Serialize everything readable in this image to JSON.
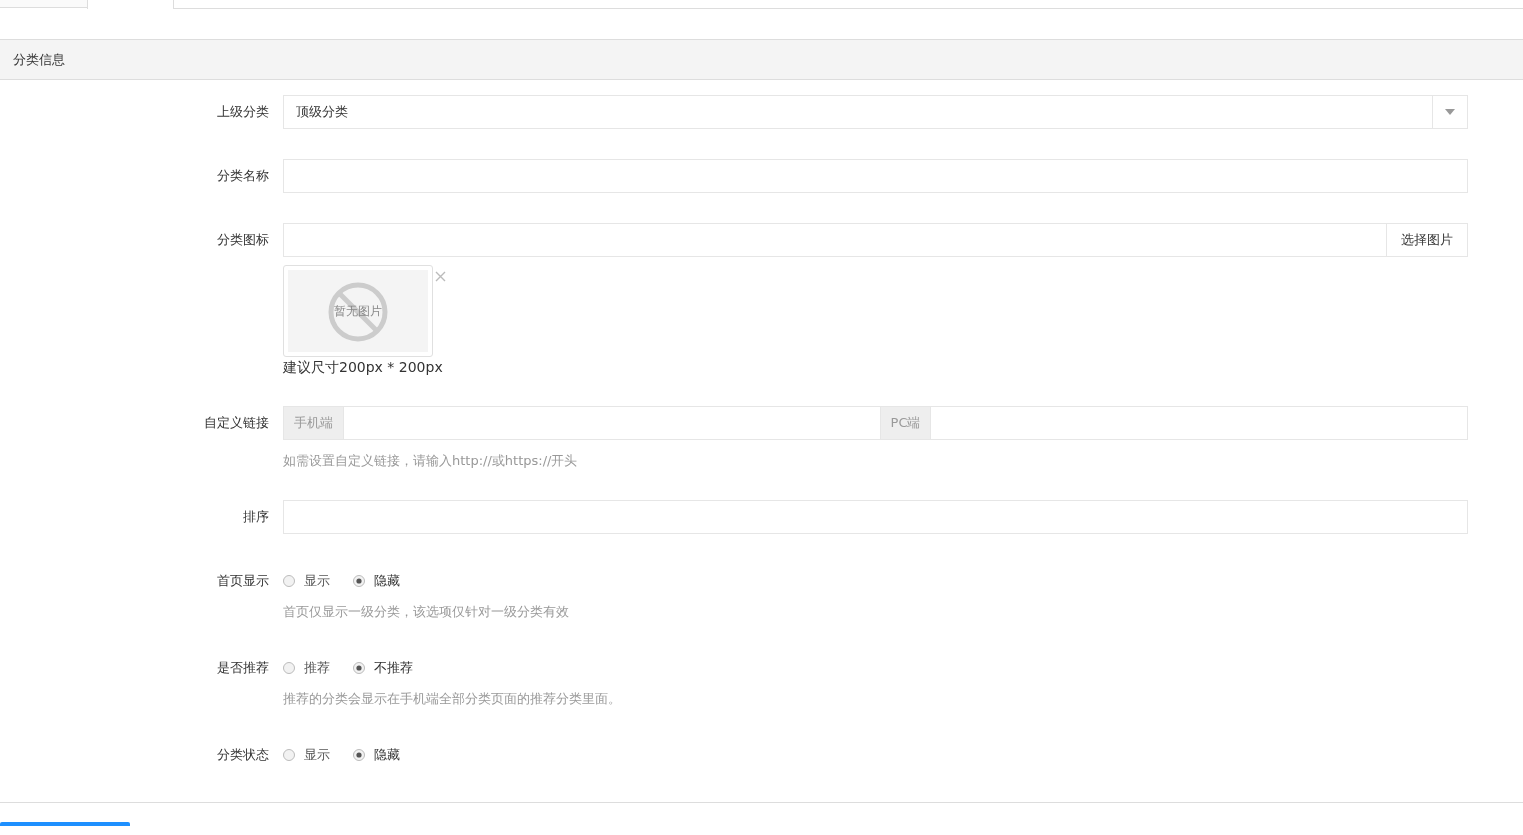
{
  "tabs": [
    {
      "selected": false
    },
    {
      "selected": true
    }
  ],
  "panel": {
    "title": "分类信息"
  },
  "fields": [
    {
      "kind": "select",
      "label": "上级分类",
      "value": "顶级分类"
    },
    {
      "kind": "text",
      "label": "分类名称"
    },
    {
      "kind": "image",
      "label": "分类图标",
      "button": "选择图片",
      "preview": "暂无图片",
      "hint": "建议尺寸200px * 200px"
    },
    {
      "kind": "link",
      "label": "自定义链接",
      "addons": [
        "手机端",
        "PC端"
      ],
      "hint": "如需设置自定义链接，请输入http://或https://开头"
    },
    {
      "kind": "text",
      "label": "排序"
    },
    {
      "kind": "radio",
      "label": "首页显示",
      "options": [
        {
          "label": "显示",
          "selected": false
        },
        {
          "label": "隐藏",
          "selected": true
        }
      ],
      "hint": "首页仅显示一级分类，该选项仅针对一级分类有效"
    },
    {
      "kind": "radio",
      "label": "是否推荐",
      "options": [
        {
          "label": "推荐",
          "selected": false
        },
        {
          "label": "不推荐",
          "selected": true
        }
      ],
      "hint": "推荐的分类会显示在手机端全部分类页面的推荐分类里面。"
    },
    {
      "kind": "radio",
      "label": "分类状态",
      "options": [
        {
          "label": "显示",
          "selected": false
        },
        {
          "label": "隐藏",
          "selected": true
        }
      ]
    }
  ]
}
